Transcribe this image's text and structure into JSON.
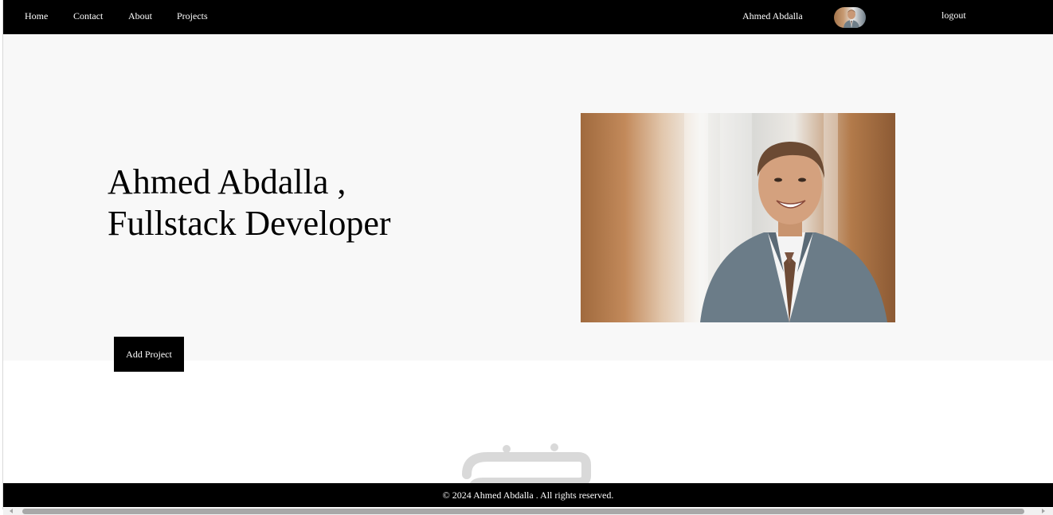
{
  "nav": {
    "links": [
      "Home",
      "Contact",
      "About",
      "Projects"
    ],
    "user_name": "Ahmed Abdalla",
    "logout_label": "logout"
  },
  "hero": {
    "title_line1": "Ahmed Abdalla ,",
    "title_line2": "Fullstack Developer",
    "add_project_label": "Add Project"
  },
  "footer": {
    "copyright": "© 2024 Ahmed Abdalla . All rights reserved."
  },
  "icons": {
    "avatar": "avatar",
    "profile_photo": "profile-photo"
  },
  "colors": {
    "nav_bg": "#000000",
    "hero_bg": "#f8f8f8",
    "button_bg": "#000000",
    "footer_bg": "#000000"
  }
}
